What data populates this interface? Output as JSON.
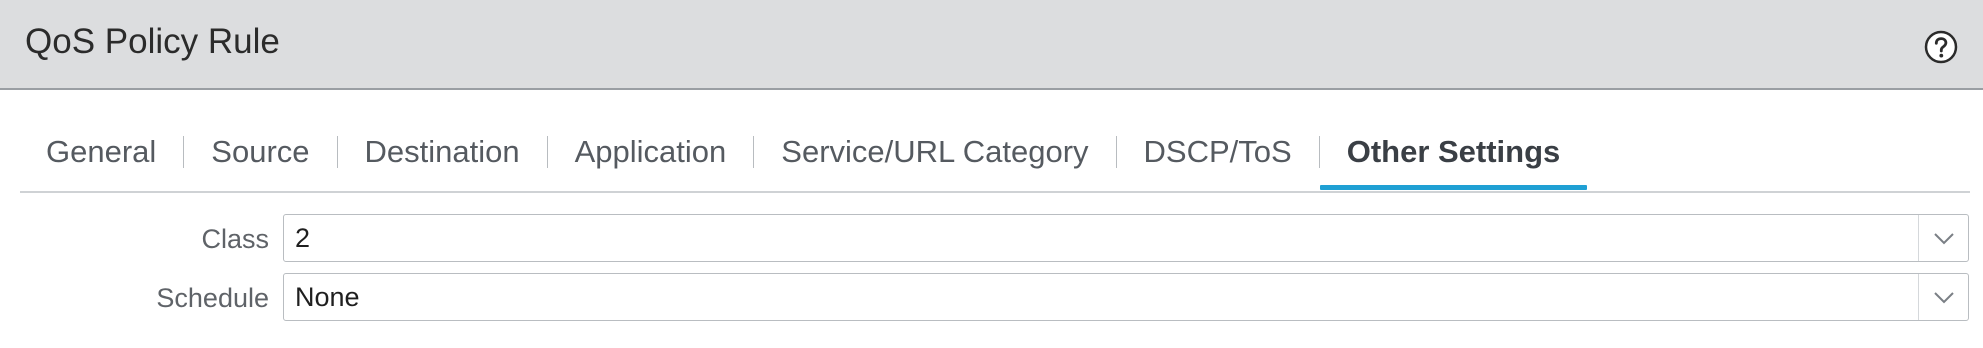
{
  "dialog": {
    "title": "QoS Policy Rule",
    "help_icon": "help-circle-icon"
  },
  "tabs": [
    {
      "label": "General",
      "active": false
    },
    {
      "label": "Source",
      "active": false
    },
    {
      "label": "Destination",
      "active": false
    },
    {
      "label": "Application",
      "active": false
    },
    {
      "label": "Service/URL Category",
      "active": false
    },
    {
      "label": "DSCP/ToS",
      "active": false
    },
    {
      "label": "Other Settings",
      "active": true
    }
  ],
  "fields": {
    "class": {
      "label": "Class",
      "value": "2"
    },
    "schedule": {
      "label": "Schedule",
      "value": "None"
    }
  },
  "colors": {
    "titlebar_bg": "#dcdddf",
    "active_tab_underline": "#1fa0d4"
  }
}
